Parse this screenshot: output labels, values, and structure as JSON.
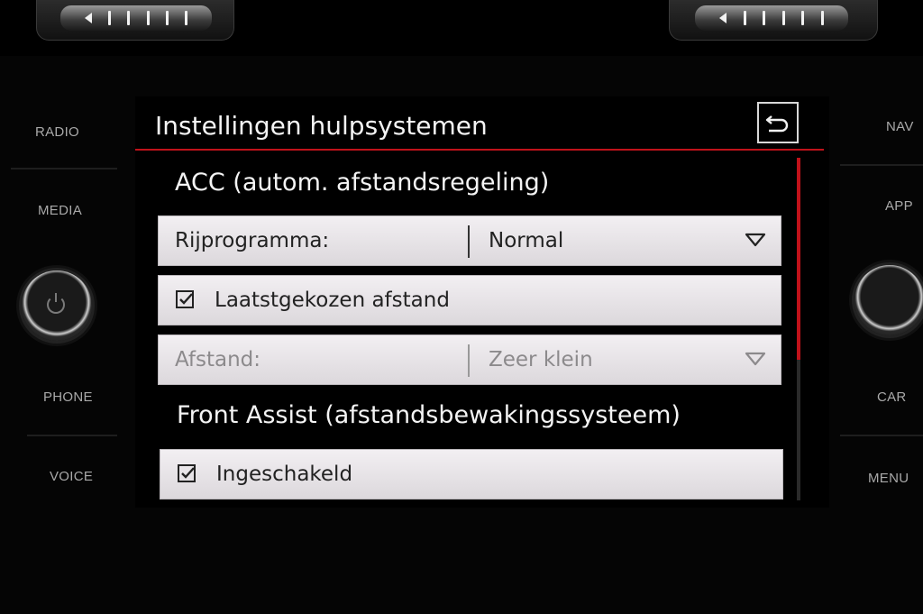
{
  "screen": {
    "title": "Instellingen hulpsystemen",
    "accent_color": "#c0121a"
  },
  "left_buttons": [
    "RADIO",
    "MEDIA",
    "PHONE",
    "VOICE"
  ],
  "right_buttons": [
    "NAV",
    "APP",
    "CAR",
    "MENU"
  ],
  "sections": {
    "acc": {
      "heading": "ACC (autom. afstandsregeling)",
      "drive_program": {
        "label": "Rijprogramma:",
        "value": "Normal"
      },
      "last_distance": {
        "label": "Laatstgekozen afstand",
        "checked": true
      },
      "distance": {
        "label": "Afstand:",
        "value": "Zeer klein",
        "enabled": false
      }
    },
    "front_assist": {
      "heading": "Front Assist (afstandsbewakingssysteem)",
      "enabled": {
        "label": "Ingeschakeld",
        "checked": true
      }
    }
  },
  "icons": {
    "back": "back-arrow-icon",
    "dropdown": "triangle-down-icon",
    "checkbox": "checkbox-checked-icon",
    "power": "power-icon"
  },
  "scrollbar": {
    "position_fraction": 0.0,
    "visible_fraction": 0.59
  }
}
